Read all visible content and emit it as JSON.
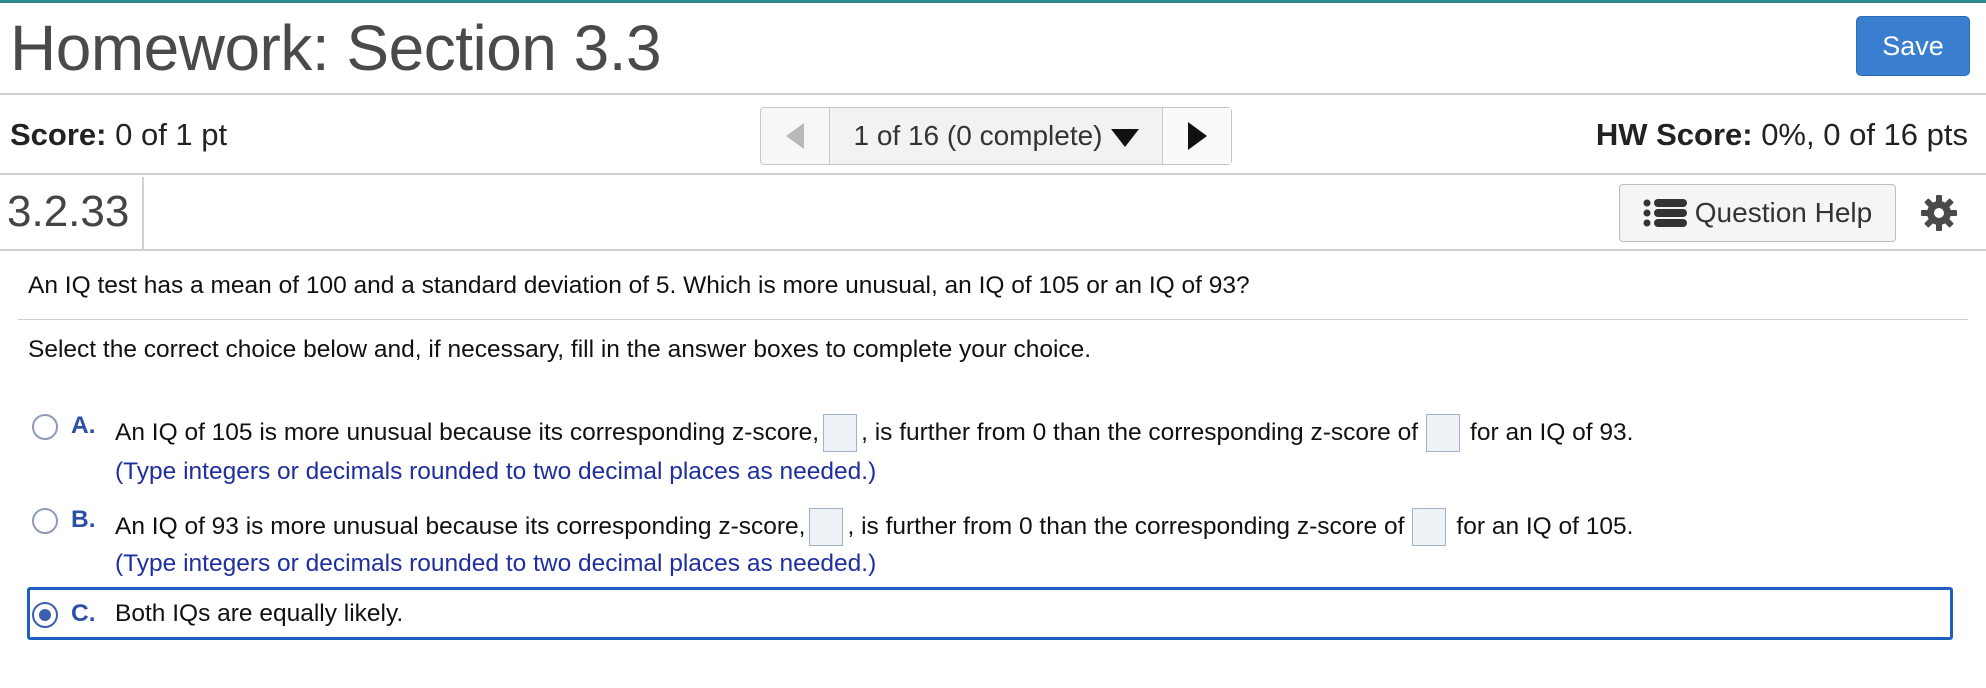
{
  "header": {
    "title": "Homework: Section 3.3",
    "save_label": "Save"
  },
  "scorebar": {
    "score_label": "Score:",
    "score_value": " 0 of 1 pt",
    "pager_text": "1 of 16 (0 complete)",
    "hw_score_label": "HW Score:",
    "hw_score_value": " 0%, 0 of 16 pts"
  },
  "question_bar": {
    "number": "3.2.33",
    "help_label": "Question Help"
  },
  "content": {
    "question": "An IQ test has a mean of 100 and a standard deviation of 5. Which is more unusual, an IQ of 105 or an IQ of 93?",
    "instruction": "Select the correct choice below and, if necessary, fill in the answer boxes to complete your choice.",
    "choices": [
      {
        "letter": "A.",
        "text_part1": "An IQ of 105 is more unusual because its corresponding z-score,",
        "text_part2": ", is further from 0 than the corresponding z-score of",
        "text_part3": "for an IQ of 93.",
        "hint": "(Type integers or decimals rounded to two decimal places as needed.)",
        "selected": false
      },
      {
        "letter": "B.",
        "text_part1": "An IQ of 93 is more unusual because its corresponding z-score,",
        "text_part2": ", is further from 0 than the corresponding z-score of",
        "text_part3": "for an IQ of 105.",
        "hint": "(Type integers or decimals rounded to two decimal places as needed.)",
        "selected": false
      },
      {
        "letter": "C.",
        "text": "Both IQs are equally likely.",
        "selected": true
      }
    ]
  },
  "icons": {
    "pager_prev": "triangle-left-icon",
    "pager_dropdown": "triangle-down-icon",
    "pager_next": "triangle-right-icon",
    "help": "list-icon",
    "settings": "gear-icon"
  },
  "colors": {
    "save_button": "#3a7fcf",
    "choice_letter": "#2c4fa8",
    "hint_text": "#1f2fa0",
    "selected_frame": "#1f5fbf"
  }
}
